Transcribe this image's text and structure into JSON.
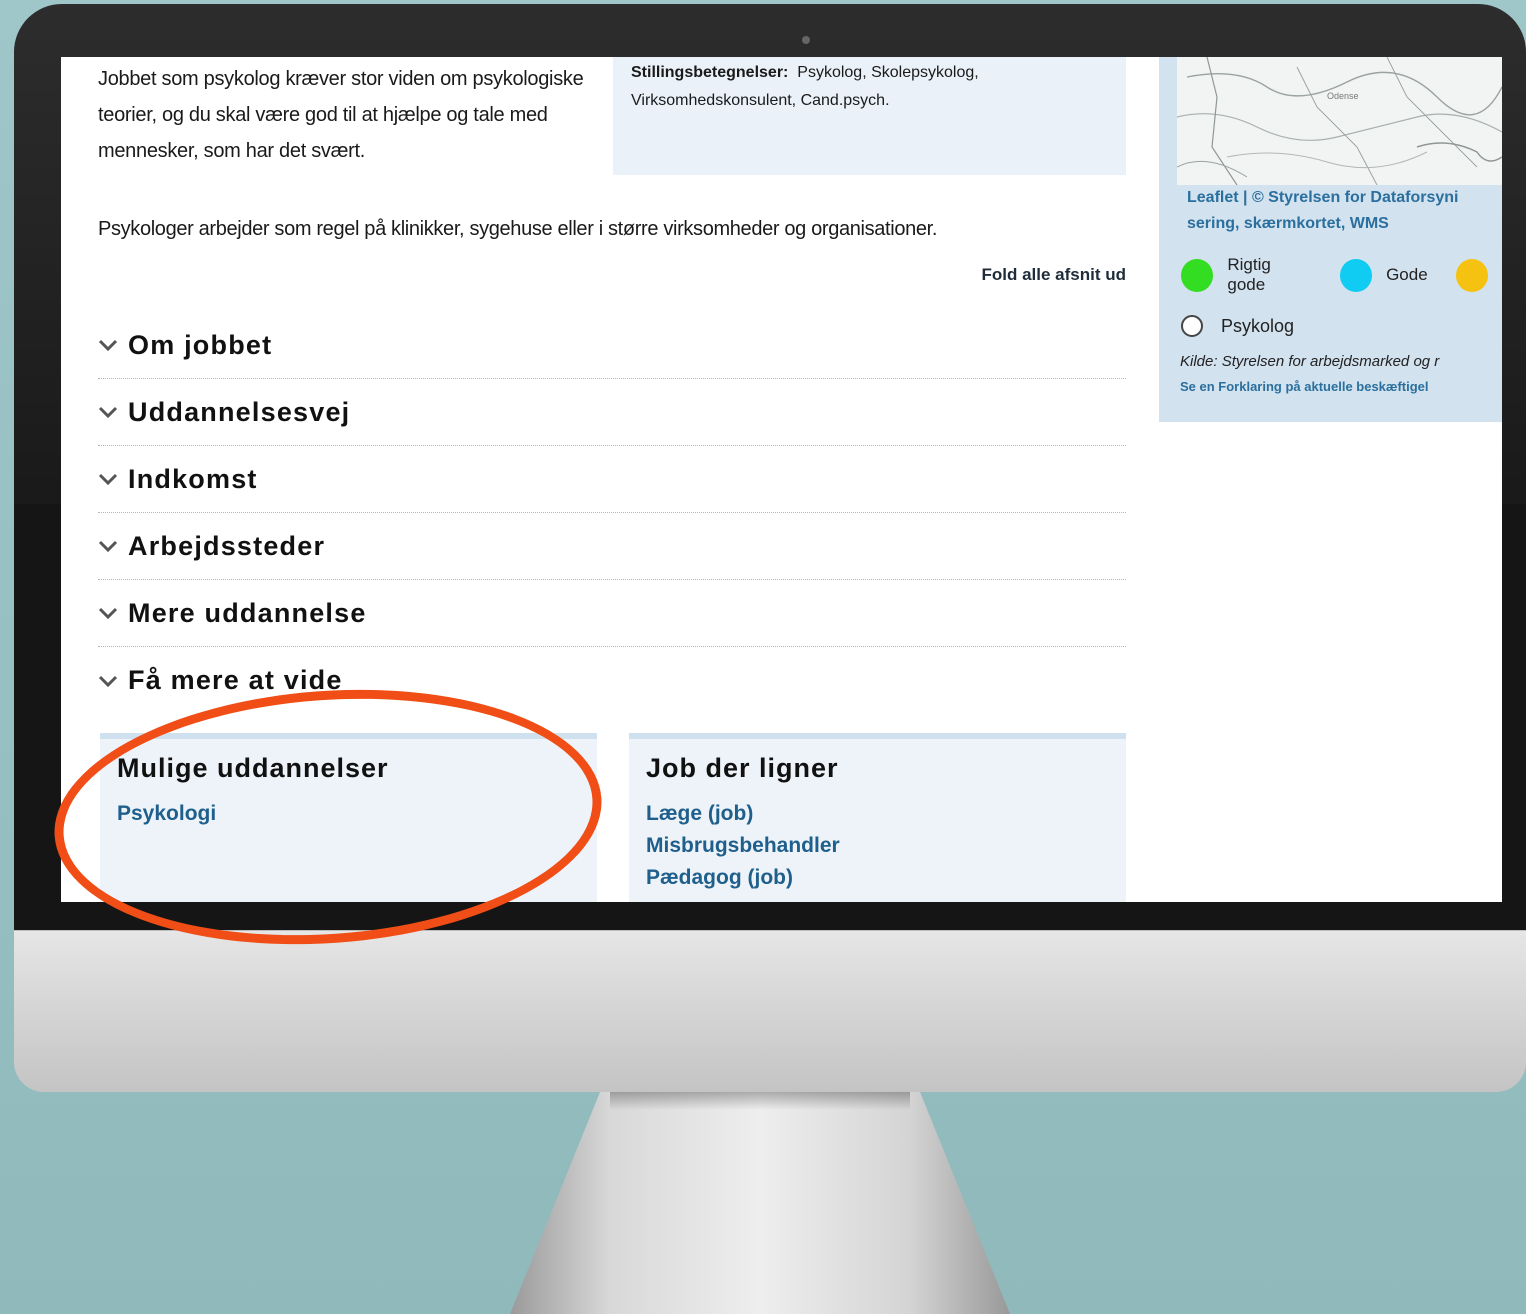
{
  "intro": {
    "paragraph1": "Jobbet som psykolog kræver stor viden om psykologiske teorier, og du skal være god til at hjælpe og tale med mennesker, som har det svært.",
    "paragraph2": "Psykologer arbejder som regel på klinikker, sygehuse eller i større virksomheder og organisationer."
  },
  "info_box": {
    "cut_line": "virksomheder",
    "titles_label": "Stillingsbetegnelser:",
    "titles_value": "Psykolog, Skolepsykolog, Virksomhedskonsulent, Cand.psych."
  },
  "fold_all_label": "Fold alle afsnit ud",
  "accordion": [
    {
      "title": "Om jobbet"
    },
    {
      "title": "Uddannelsesvej"
    },
    {
      "title": "Indkomst"
    },
    {
      "title": "Arbejdssteder"
    },
    {
      "title": "Mere uddannelse"
    },
    {
      "title": "Få mere at vide"
    }
  ],
  "educations": {
    "heading": "Mulige uddannelser",
    "links": [
      "Psykologi"
    ]
  },
  "similar_jobs": {
    "heading": "Job der ligner",
    "links": [
      "Læge (job)",
      "Misbrugsbehandler",
      "Pædagog (job)"
    ]
  },
  "sidebar": {
    "map_city": "Odense",
    "map_attribution_part1": "Leaflet | © Styrelsen for Dataforsyni",
    "map_attribution_part2": "sering, skærmkortet, WMS",
    "legend": [
      {
        "label": "Rigtig gode",
        "color": "#33dd22"
      },
      {
        "label": "Gode",
        "color": "#11ccf2"
      },
      {
        "label": "",
        "color": "#f5c211"
      }
    ],
    "radio_label": "Psykolog",
    "source": "Kilde: Styrelsen for arbejdsmarked og r",
    "explanation": "Se en Forklaring på aktuelle beskæftigel"
  },
  "annotation_color": "#f04e16"
}
